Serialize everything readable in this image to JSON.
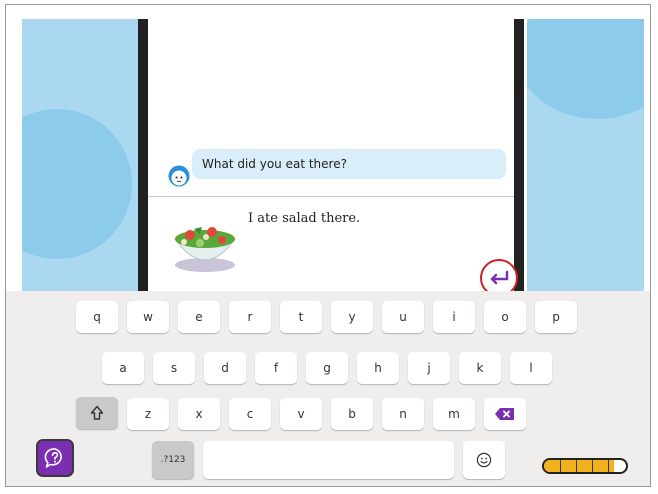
{
  "chat": {
    "question": "What did you eat there?",
    "answer": "I ate salad there."
  },
  "keyboard": {
    "row1": [
      "q",
      "w",
      "e",
      "r",
      "t",
      "y",
      "u",
      "i",
      "o",
      "p"
    ],
    "row2": [
      "a",
      "s",
      "d",
      "f",
      "g",
      "h",
      "j",
      "k",
      "l"
    ],
    "row3": [
      "z",
      "x",
      "c",
      "v",
      "b",
      "n",
      "m"
    ],
    "numbers_key": ".?123"
  },
  "icons": {
    "enter": "enter-arrow-icon",
    "shift": "shift-arrow-icon",
    "backspace": "backspace-icon",
    "emoji": "emoji-icon",
    "help": "help-speech-icon",
    "avatar": "child-avatar-icon",
    "salad": "salad-bowl-image"
  },
  "colors": {
    "sky": "#a9d8f0",
    "bubble": "#d9eef9",
    "accent_purple": "#7a2fb0",
    "progress_yellow": "#f2b21c",
    "highlight_red": "#cc2222"
  },
  "progress": {
    "filled_fraction": 0.85,
    "segments": 5
  }
}
